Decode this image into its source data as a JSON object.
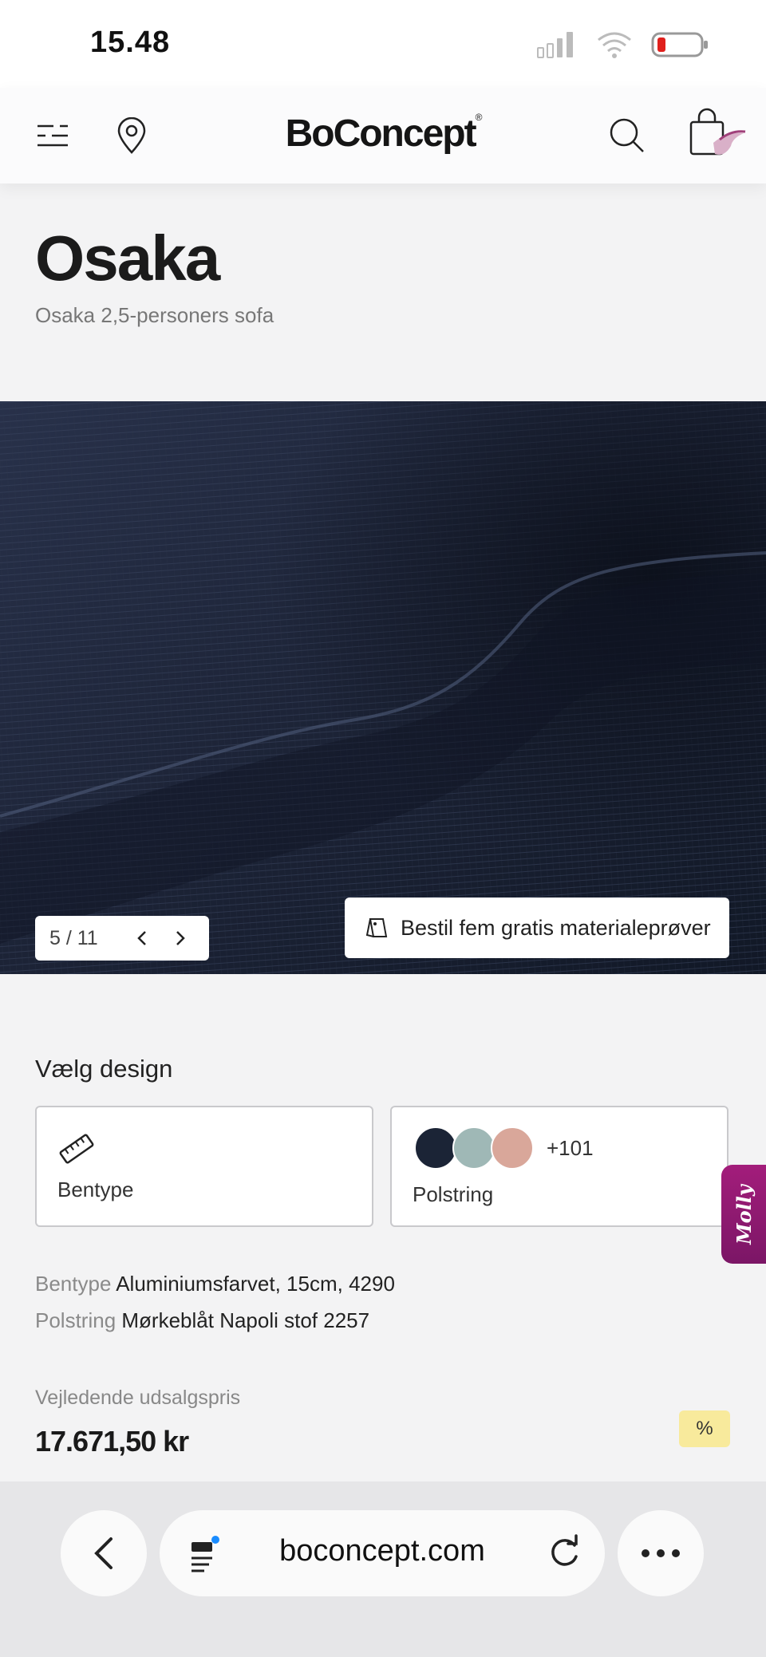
{
  "status": {
    "time": "15.48"
  },
  "header": {
    "brand": "BoConcept",
    "registered_mark": "®",
    "icons": [
      "menu-icon",
      "location-pin-icon",
      "search-icon",
      "shopping-bag-icon"
    ]
  },
  "product": {
    "title": "Osaka",
    "subtitle": "Osaka 2,5-personers sofa"
  },
  "gallery": {
    "counter": "5 / 11",
    "samples_button": "Bestil fem gratis materialeprøver"
  },
  "design": {
    "heading": "Vælg design",
    "legs_card": {
      "label": "Bentype"
    },
    "upholstery_card": {
      "label": "Polstring",
      "more_count": "+101",
      "swatch_colors": [
        "#1b2436",
        "#9fb8b6",
        "#d9a79a"
      ]
    }
  },
  "specs": [
    {
      "key": "Bentype",
      "value": "Aluminiumsfarvet, 15cm, 4290"
    },
    {
      "key": "Polstring",
      "value": "Mørkeblåt Napoli stof 2257"
    }
  ],
  "price": {
    "caption": "Vejledende udsalgspris",
    "value": "17.671,50 kr",
    "badge": "%"
  },
  "chat": {
    "label": "Molly"
  },
  "browser": {
    "url": "boconcept.com"
  },
  "colors": {
    "background": "#f3f3f4",
    "fabric": "#1b2232",
    "molly": "#a31d7b",
    "discount_badge": "#f8ea9c"
  }
}
